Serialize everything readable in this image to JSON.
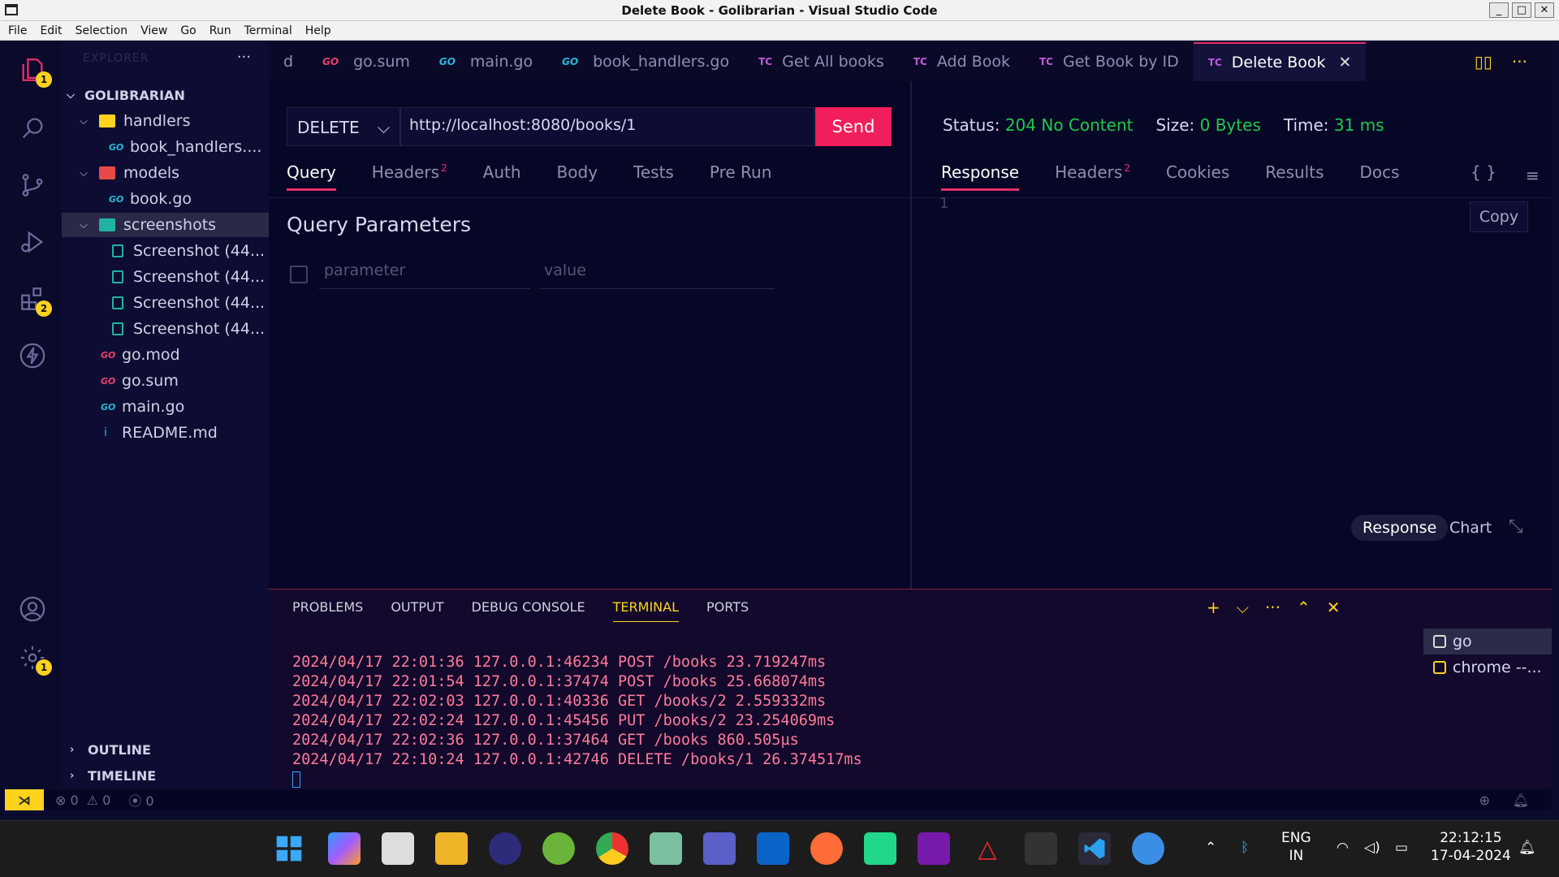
{
  "window": {
    "title": "Delete Book - Golibrarian - Visual Studio Code"
  },
  "menu": [
    "File",
    "Edit",
    "Selection",
    "View",
    "Go",
    "Run",
    "Terminal",
    "Help"
  ],
  "activity": {
    "explorer_badge": "1",
    "extensions_badge": "2",
    "settings_badge": "1"
  },
  "sidebar": {
    "header": "EXPLORER",
    "root": "GOLIBRARIAN",
    "items": [
      {
        "label": "handlers"
      },
      {
        "label": "book_handlers...."
      },
      {
        "label": "models"
      },
      {
        "label": "book.go"
      },
      {
        "label": "screenshots"
      },
      {
        "label": "Screenshot (44..."
      },
      {
        "label": "Screenshot (44..."
      },
      {
        "label": "Screenshot (44..."
      },
      {
        "label": "Screenshot (44..."
      },
      {
        "label": "go.mod"
      },
      {
        "label": "go.sum"
      },
      {
        "label": "main.go"
      },
      {
        "label": "README.md"
      }
    ],
    "outline": "OUTLINE",
    "timeline": "TIMELINE"
  },
  "tabs": [
    {
      "label": "d",
      "icon": ""
    },
    {
      "label": "go.sum",
      "icon": "GO"
    },
    {
      "label": "main.go",
      "icon": "GO"
    },
    {
      "label": "book_handlers.go",
      "icon": "GO"
    },
    {
      "label": "Get All books",
      "icon": "TC"
    },
    {
      "label": "Add Book",
      "icon": "TC"
    },
    {
      "label": "Get Book by ID",
      "icon": "TC"
    },
    {
      "label": "Delete Book",
      "icon": "TC"
    }
  ],
  "request": {
    "method": "DELETE",
    "url": "http://localhost:8080/books/1",
    "send": "Send",
    "tabs": [
      "Query",
      "Headers",
      "Auth",
      "Body",
      "Tests",
      "Pre Run"
    ],
    "headers_count": "2",
    "query_title": "Query Parameters",
    "param_placeholder": "parameter",
    "value_placeholder": "value"
  },
  "response": {
    "status_label": "Status:",
    "status_value": "204 No Content",
    "size_label": "Size:",
    "size_value": "0 Bytes",
    "time_label": "Time:",
    "time_value": "31 ms",
    "tabs": [
      "Response",
      "Headers",
      "Cookies",
      "Results",
      "Docs"
    ],
    "headers_count": "2",
    "braces": "{ }",
    "line": "1",
    "copy": "Copy",
    "view_response": "Response",
    "view_chart": "Chart"
  },
  "panel": {
    "tabs": [
      "PROBLEMS",
      "OUTPUT",
      "DEBUG CONSOLE",
      "TERMINAL",
      "PORTS"
    ],
    "lines": [
      "2024/04/17 22:01:36 127.0.0.1:46234 POST /books 23.719247ms",
      "2024/04/17 22:01:54 127.0.0.1:37474 POST /books 25.668074ms",
      "2024/04/17 22:02:03 127.0.0.1:40336 GET /books/2 2.559332ms",
      "2024/04/17 22:02:24 127.0.0.1:45456 PUT /books/2 23.254069ms",
      "2024/04/17 22:02:36 127.0.0.1:37464 GET /books 860.505µs",
      "2024/04/17 22:10:24 127.0.0.1:42746 DELETE /books/1 26.374517ms"
    ],
    "terminals": [
      "go",
      "chrome --..."
    ]
  },
  "statusbar": {
    "errors": "0",
    "warnings": "0",
    "ports": "0"
  },
  "taskbar": {
    "lang": "ENG",
    "region": "IN",
    "time": "22:12:15",
    "date": "17-04-2024"
  }
}
